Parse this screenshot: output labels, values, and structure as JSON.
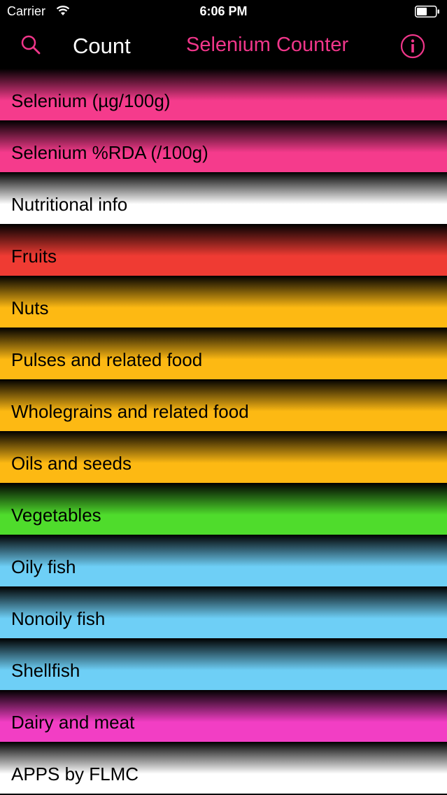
{
  "status_bar": {
    "carrier": "Carrier",
    "time": "6:06 PM"
  },
  "nav": {
    "count_label": "Count",
    "title": "Selenium Counter",
    "accent_color": "#f0368a"
  },
  "list": [
    {
      "label": "Selenium (µg/100g)",
      "color": "#f53b8c"
    },
    {
      "label": "Selenium %RDA (/100g)",
      "color": "#f53b8c"
    },
    {
      "label": "Nutritional info",
      "color": "#ffffff"
    },
    {
      "label": "Fruits",
      "color": "#ef3b33"
    },
    {
      "label": "Nuts",
      "color": "#fdb913"
    },
    {
      "label": "Pulses and related food",
      "color": "#fdb913"
    },
    {
      "label": "Wholegrains and related food",
      "color": "#fdb913"
    },
    {
      "label": "Oils and seeds",
      "color": "#fdb913"
    },
    {
      "label": "Vegetables",
      "color": "#4fdc2c"
    },
    {
      "label": "Oily fish",
      "color": "#6ecff6"
    },
    {
      "label": "Nonoily fish",
      "color": "#6ecff6"
    },
    {
      "label": "Shellfish",
      "color": "#6ecff6"
    },
    {
      "label": "Dairy and meat",
      "color": "#f23ec4"
    },
    {
      "label": "APPS by FLMC",
      "color": "#ffffff"
    }
  ]
}
